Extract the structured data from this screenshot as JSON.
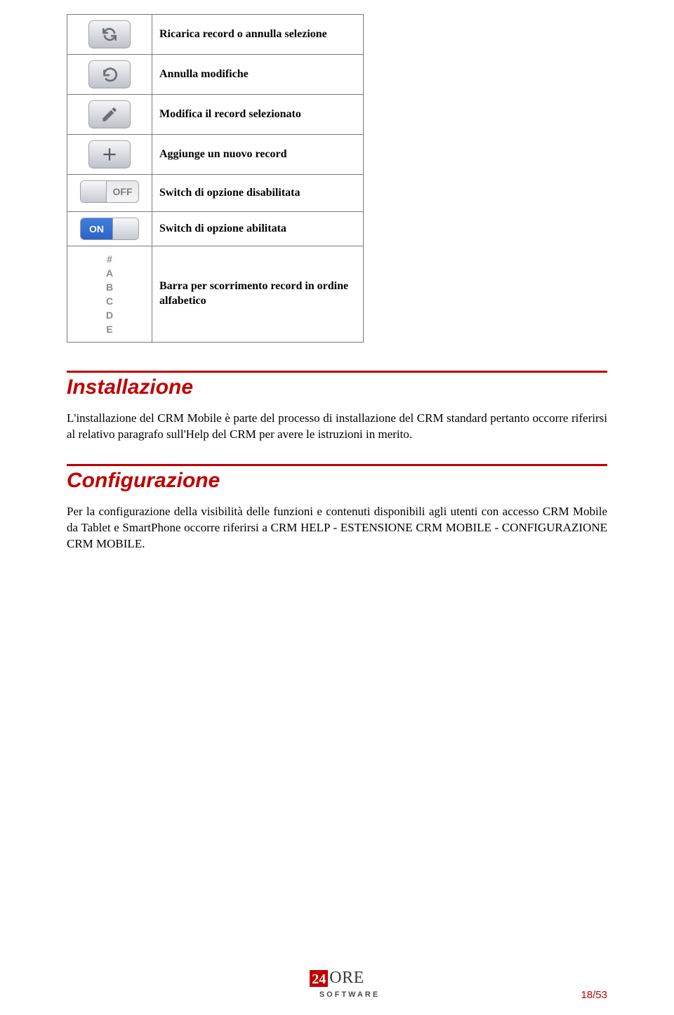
{
  "icons": {
    "reload": {
      "desc": "Ricarica record o annulla selezione"
    },
    "undo": {
      "desc": "Annulla modifiche"
    },
    "edit": {
      "desc": "Modifica il record selezionato"
    },
    "add": {
      "desc": "Aggiunge un nuovo record"
    },
    "sw_off": {
      "label": "OFF",
      "desc": "Switch di opzione disabilitata"
    },
    "sw_on": {
      "label": "ON",
      "desc": "Switch di opzione abilitata"
    },
    "alpha": {
      "items": [
        "#",
        "A",
        "B",
        "C",
        "D",
        "E"
      ],
      "desc": "Barra per scorrimento record in ordine alfabetico"
    }
  },
  "sections": {
    "install": {
      "title": "Installazione",
      "text": "L'installazione del CRM Mobile è parte del processo di installazione del CRM standard pertanto occorre riferirsi al relativo paragrafo sull'Help del CRM per avere le istruzioni in merito."
    },
    "config": {
      "title": "Configurazione",
      "text": "Per la configurazione della visibilità delle funzioni e contenuti disponibili agli utenti con accesso CRM Mobile da Tablet e SmartPhone occorre riferirsi a CRM HELP - ESTENSIONE CRM MOBILE - CONFIGURAZIONE CRM MOBILE."
    }
  },
  "footer": {
    "logo_sq": "24",
    "logo_ore": "ORE",
    "logo_sub": "SOFTWARE",
    "page": "18/53"
  }
}
